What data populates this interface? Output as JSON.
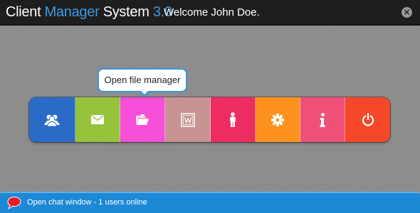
{
  "header": {
    "brand": {
      "part1": "Client ",
      "part2": "Manager",
      "part3": " System",
      "part4": " 3.0"
    },
    "welcome": "Welcome John Doe.",
    "close_label": "×"
  },
  "tooltip": {
    "text": "Open file manager"
  },
  "menu": {
    "items": [
      {
        "name": "clients",
        "icon": "users-icon",
        "color": "#2b6bc8"
      },
      {
        "name": "messages",
        "icon": "envelope-icon",
        "color": "#96c23c"
      },
      {
        "name": "files",
        "icon": "folder-icon",
        "color": "#f550d7"
      },
      {
        "name": "documents",
        "icon": "word-doc-icon",
        "color": "#c79393"
      },
      {
        "name": "profile",
        "icon": "person-icon",
        "color": "#ef2c61"
      },
      {
        "name": "settings",
        "icon": "gear-icon",
        "color": "#ff921f"
      },
      {
        "name": "info",
        "icon": "info-icon",
        "color": "#ef5077"
      },
      {
        "name": "logout",
        "icon": "power-icon",
        "color": "#f5472a"
      }
    ]
  },
  "chat": {
    "label": "Open chat window - 1 users online",
    "icon": "chat-bubble-icon"
  },
  "colors": {
    "topbar": "#1e1e1e",
    "accent": "#3b9ae1",
    "chatbar": "#1d89d6"
  }
}
